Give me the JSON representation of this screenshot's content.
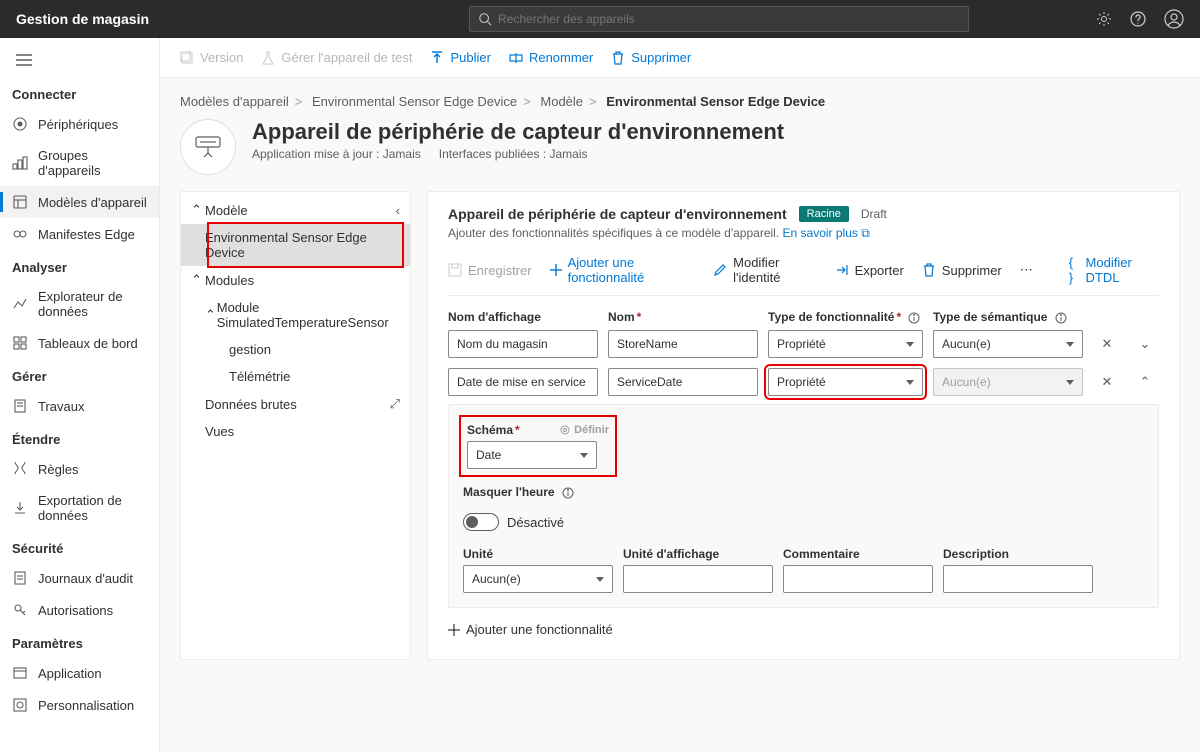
{
  "topbar": {
    "title": "Gestion de magasin",
    "search_placeholder": "Rechercher des appareils"
  },
  "sidebar": {
    "sections": [
      {
        "label": "Connecter",
        "items": [
          {
            "label": "Périphériques",
            "icon": "devices"
          },
          {
            "label": "Groupes d'appareils",
            "icon": "groups"
          },
          {
            "label": "Modèles d'appareil",
            "icon": "templates",
            "active": true
          },
          {
            "label": "Manifestes Edge",
            "icon": "edge"
          }
        ]
      },
      {
        "label": "Analyser",
        "items": [
          {
            "label": "Explorateur de données",
            "icon": "explorer"
          },
          {
            "label": "Tableaux de bord",
            "icon": "dashboard"
          }
        ]
      },
      {
        "label": "Gérer",
        "items": [
          {
            "label": "Travaux",
            "icon": "jobs"
          }
        ]
      },
      {
        "label": "Étendre",
        "items": [
          {
            "label": "Règles",
            "icon": "rules"
          },
          {
            "label": "Exportation de données",
            "icon": "export"
          }
        ]
      },
      {
        "label": "Sécurité",
        "items": [
          {
            "label": "Journaux d'audit",
            "icon": "audit"
          },
          {
            "label": "Autorisations",
            "icon": "perm"
          }
        ]
      },
      {
        "label": "Paramètres",
        "items": [
          {
            "label": "Application",
            "icon": "app"
          },
          {
            "label": "Personnalisation",
            "icon": "custom"
          }
        ]
      }
    ]
  },
  "cmdbar": {
    "version": "Version",
    "manage": "Gérer l'appareil de test",
    "publish": "Publier",
    "rename": "Renommer",
    "delete": "Supprimer"
  },
  "breadcrumb": {
    "a": "Modèles d'appareil",
    "b": "Environmental Sensor Edge Device",
    "c": "Modèle",
    "d": "Environmental Sensor Edge Device"
  },
  "header": {
    "title": "Appareil de périphérie de capteur d'environnement",
    "app_updated": "Application mise à jour : Jamais",
    "interfaces": "Interfaces publiées : Jamais"
  },
  "tree": {
    "model": "Modèle",
    "device": "Environmental Sensor Edge Device",
    "modules": "Modules",
    "module1": "Module SimulatedTemperatureSensor",
    "mgmt": "gestion",
    "telemetry": "Télémétrie",
    "raw": "Données brutes",
    "views": "Vues"
  },
  "form": {
    "title": "Appareil de périphérie de capteur d'environnement",
    "badge": "Racine",
    "draft": "Draft",
    "desc": "Ajouter des fonctionnalités spécifiques à ce modèle d'appareil.",
    "learn_more": "En savoir plus",
    "tb": {
      "save": "Enregistrer",
      "add": "Ajouter une fonctionnalité",
      "identity": "Modifier l'identité",
      "export": "Exporter",
      "delete": "Supprimer",
      "dtdl": "Modifier DTDL"
    },
    "cols": {
      "display": "Nom d'affichage",
      "name": "Nom",
      "cap": "Type de fonctionnalité",
      "sem": "Type de sémantique"
    },
    "rows": [
      {
        "display": "Nom du magasin",
        "name": "StoreName",
        "cap": "Propriété",
        "sem": "Aucun(e)",
        "expanded": false
      },
      {
        "display": "Date de mise en service",
        "name": "ServiceDate",
        "cap": "Propriété",
        "sem": "Aucun(e)",
        "expanded": true,
        "sem_disabled": true
      }
    ],
    "expanded": {
      "schema_label": "Schéma",
      "define": "Définir",
      "schema_value": "Date",
      "hide_time": "Masquer l'heure",
      "toggle_state": "Désactivé",
      "unit": "Unité",
      "unit_value": "Aucun(e)",
      "display_unit": "Unité d'affichage",
      "comment": "Commentaire",
      "description": "Description"
    },
    "add_capability": "Ajouter une fonctionnalité"
  }
}
